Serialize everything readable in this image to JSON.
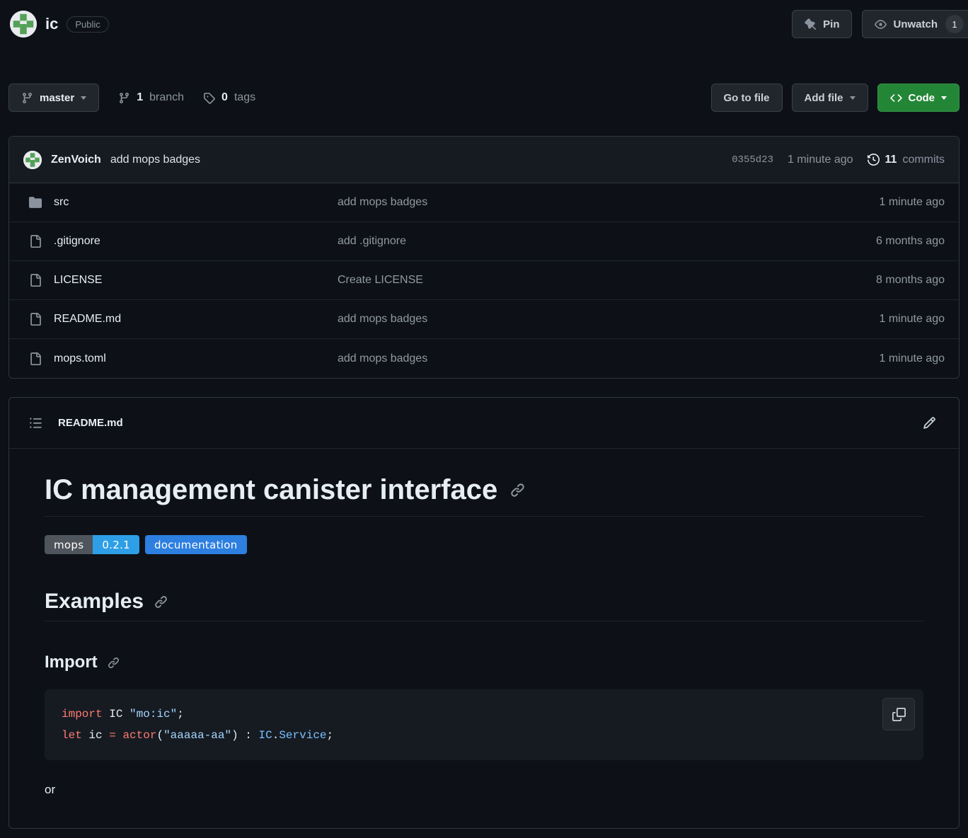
{
  "repo": {
    "name": "ic",
    "visibility_label": "Public"
  },
  "actions": {
    "pin_label": "Pin",
    "unwatch_label": "Unwatch",
    "unwatch_count": "1"
  },
  "toolbar": {
    "branch_name": "master",
    "branch_count": "1",
    "branch_count_label": "branch",
    "tag_count": "0",
    "tag_count_label": "tags",
    "go_to_file_label": "Go to file",
    "add_file_label": "Add file",
    "code_label": "Code"
  },
  "commit_bar": {
    "author": "ZenVoich",
    "message": "add mops badges",
    "sha": "0355d23",
    "time": "1 minute ago",
    "commit_count": "11",
    "commit_count_label": "commits"
  },
  "files": [
    {
      "type": "folder",
      "name": "src",
      "message": "add mops badges",
      "time": "1 minute ago"
    },
    {
      "type": "file",
      "name": ".gitignore",
      "message": "add .gitignore",
      "time": "6 months ago"
    },
    {
      "type": "file",
      "name": "LICENSE",
      "message": "Create LICENSE",
      "time": "8 months ago"
    },
    {
      "type": "file",
      "name": "README.md",
      "message": "add mops badges",
      "time": "1 minute ago"
    },
    {
      "type": "file",
      "name": "mops.toml",
      "message": "add mops badges",
      "time": "1 minute ago"
    }
  ],
  "readme": {
    "header_filename": "README.md",
    "title": "IC management canister interface",
    "badges": {
      "mops_label": "mops",
      "mops_version": "0.2.1",
      "documentation_label": "documentation"
    },
    "examples_heading": "Examples",
    "import_heading": "Import",
    "code_lines": [
      {
        "tokens": [
          {
            "t": "import"
          },
          {
            "t": " IC "
          },
          {
            "t": "\"mo:ic\""
          },
          {
            "t": ";"
          }
        ]
      },
      {
        "tokens": [
          {
            "t": "let"
          },
          {
            "t": " ic "
          },
          {
            "t": "="
          },
          {
            "t": " "
          },
          {
            "t": "actor"
          },
          {
            "t": "("
          },
          {
            "t": "\"aaaaa-aa\""
          },
          {
            "t": ")"
          },
          {
            "t": " : "
          },
          {
            "t": "IC"
          },
          {
            "t": "."
          },
          {
            "t": "Service"
          },
          {
            "t": ";"
          }
        ]
      }
    ],
    "or_text": "or"
  },
  "colors": {
    "page_bg": "#0d1117",
    "panel_bg": "#161b22",
    "border": "#30363d",
    "muted_text": "#8b949e",
    "primary_green": "#238636",
    "badge_gray": "#4f555c",
    "badge_version_blue": "#2e9fe6",
    "badge_doc_blue": "#2d7fe0",
    "syntax_keyword": "#ff7b72",
    "syntax_string": "#a5d6ff",
    "syntax_type": "#79c0ff"
  }
}
